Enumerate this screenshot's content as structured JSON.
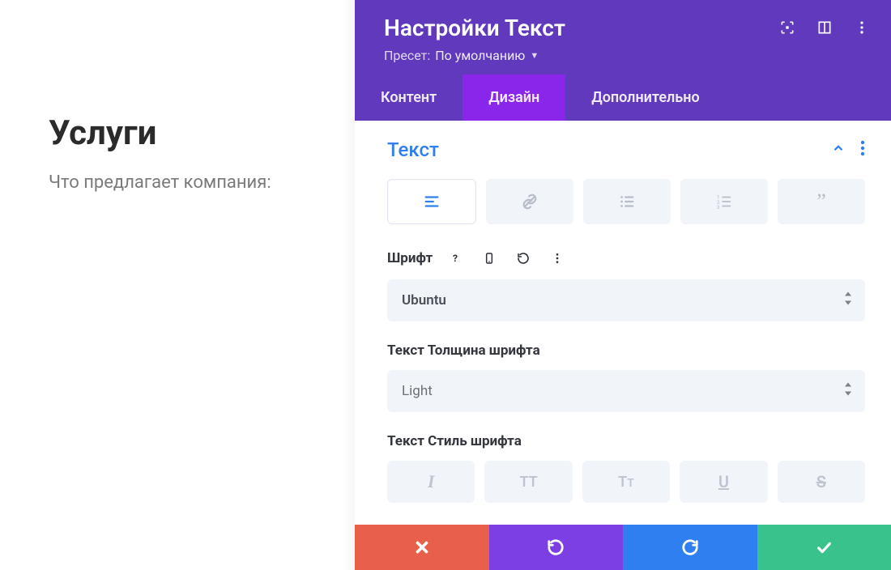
{
  "canvas": {
    "heading": "Услуги",
    "subtitle": "Что предлагает компания:"
  },
  "panel": {
    "header": {
      "title": "Настройки Текст",
      "preset_label": "Пресет:",
      "preset_value": "По умолчанию"
    },
    "tabs": {
      "content": "Контент",
      "design": "Дизайн",
      "advanced": "Дополнительно"
    },
    "section": {
      "title": "Текст"
    },
    "font": {
      "label": "Шрифт",
      "value": "Ubuntu"
    },
    "weight": {
      "label": "Текст Толщина шрифта",
      "value": "Light"
    },
    "style": {
      "label": "Текст Стиль шрифта"
    }
  }
}
